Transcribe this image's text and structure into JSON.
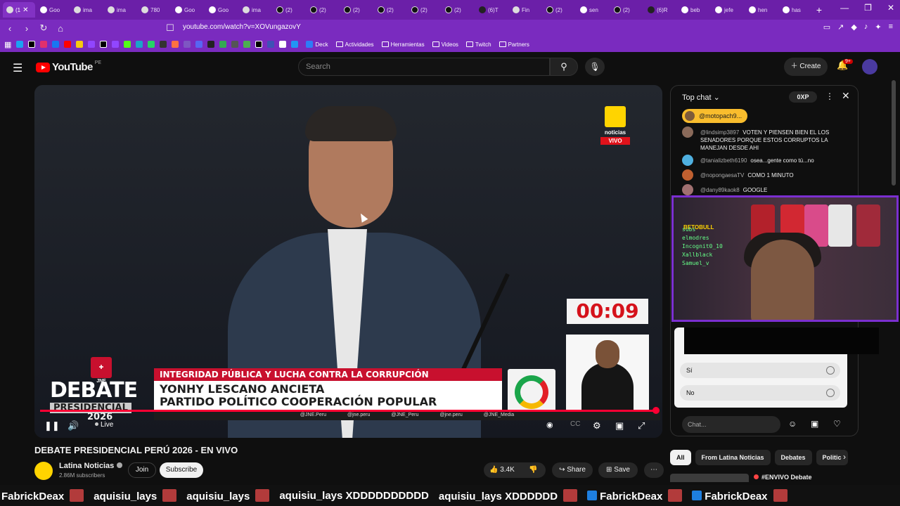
{
  "browser": {
    "tabs": [
      {
        "label": "(1",
        "icon": "twitch-icon",
        "active": true
      },
      {
        "label": "Goo",
        "icon": "google-icon"
      },
      {
        "label": "ima",
        "icon": "globe-icon"
      },
      {
        "label": "ima",
        "icon": "globe-icon"
      },
      {
        "label": "780",
        "icon": "globe-icon"
      },
      {
        "label": "Goo",
        "icon": "google-icon"
      },
      {
        "label": "Goo",
        "icon": "google-icon"
      },
      {
        "label": "ima",
        "icon": "globe-icon"
      },
      {
        "label": "(2)",
        "icon": "x-icon"
      },
      {
        "label": "(2)",
        "icon": "x-icon"
      },
      {
        "label": "(2)",
        "icon": "x-icon"
      },
      {
        "label": "(2)",
        "icon": "x-icon"
      },
      {
        "label": "(2)",
        "icon": "x-icon"
      },
      {
        "label": "(2)",
        "icon": "x-icon"
      },
      {
        "label": "(6)T",
        "icon": "tiktok-icon"
      },
      {
        "label": "Fin",
        "icon": "globe-icon"
      },
      {
        "label": "(2)",
        "icon": "x-icon"
      },
      {
        "label": "sen",
        "icon": "google-icon"
      },
      {
        "label": "(2)",
        "icon": "x-icon"
      },
      {
        "label": "(6)R",
        "icon": "tiktok-icon"
      },
      {
        "label": "beb",
        "icon": "google-icon"
      },
      {
        "label": "jefe",
        "icon": "google-icon"
      },
      {
        "label": "hen",
        "icon": "google-icon"
      },
      {
        "label": "has",
        "icon": "google-icon"
      }
    ],
    "url": "youtube.com/watch?v=XOVungazovY",
    "bookmarks": [
      "Deck",
      "Actividades",
      "Herramientas",
      "Videos",
      "Twitch",
      "Partners"
    ]
  },
  "youtube": {
    "logo": "YouTube",
    "country": "PE",
    "search_placeholder": "Search",
    "create_label": "Create",
    "notif_count": "9+"
  },
  "video": {
    "broadcaster_word": "noticias",
    "broadcaster_live": "VIVO",
    "timer": "00:09",
    "jne_label": "JNE",
    "debate_title": "DEBATE",
    "debate_sub": "PRESIDENCIAL",
    "debate_year": "2026",
    "lower_third_topic": "INTEGRIDAD PÚBLICA Y LUCHA CONTRA LA CORRUPCIÓN",
    "lower_third_name": "YONHY LESCANO ANCIETA",
    "lower_third_party": "PARTIDO POLÍTICO COOPERACIÓN POPULAR",
    "socials": [
      "@JNE.Peru",
      "@jne.peru",
      "@JNE_Peru",
      "@jne.peru",
      "@JNE_Media"
    ],
    "live_label": "Live",
    "progress": 1.0
  },
  "meta": {
    "title": "DEBATE PRESIDENCIAL PERÚ 2026 - EN VIVO",
    "channel": "Latina Noticias",
    "subscribers": "2.86M subscribers",
    "join": "Join",
    "subscribe": "Subscribe",
    "likes": "3.4K",
    "share": "Share",
    "save": "Save"
  },
  "chat": {
    "mode": "Top chat",
    "xp": "0XP",
    "pinned_user": "@motopach9...",
    "messages": [
      {
        "author": "@lindsimp3897",
        "text": "VOTEN Y PIENSEN BIEN EL LOS SENADORES PORQUE ESTOS CORRUPTOS LA MANEJAN DESDE AHI",
        "color": "#8a6a5a"
      },
      {
        "author": "@tanializbeth6190",
        "text": "osea...gente como tú...no",
        "color": "#4fb0e0"
      },
      {
        "author": "@nopongaesaTV",
        "text": "COMO 1 MINUTO",
        "color": "#c06030"
      },
      {
        "author": "@dany89kaok8",
        "text": "GOOGLE",
        "color": "#a07070"
      }
    ],
    "poll_options": [
      "Sí",
      "No"
    ],
    "input_placeholder": "Chat..."
  },
  "overlay": {
    "brand": "BETOBULL",
    "names": [
      "subs",
      "elmodres",
      "Incognit0_10",
      "Xallblack",
      "Samuel_v"
    ]
  },
  "related": {
    "chips": [
      "All",
      "From Latina Noticias",
      "Debates",
      "Politic"
    ],
    "first_title": "#ENVIVO Debate"
  },
  "ticker": [
    {
      "text": "FabrickDeax",
      "icon": "emote"
    },
    {
      "text": "aquisiu_lays",
      "icon": "emote"
    },
    {
      "text": "aquisiu_lays",
      "icon": "emote"
    },
    {
      "text": "aquisiu_lays XDDDDDDDDDD",
      "icon": "none"
    },
    {
      "text": "aquisiu_lays XDDDDDD",
      "icon": "emote"
    },
    {
      "text": "FabrickDeax",
      "icon": "emote"
    },
    {
      "text": "FabrickDeax",
      "icon": "emote"
    }
  ]
}
